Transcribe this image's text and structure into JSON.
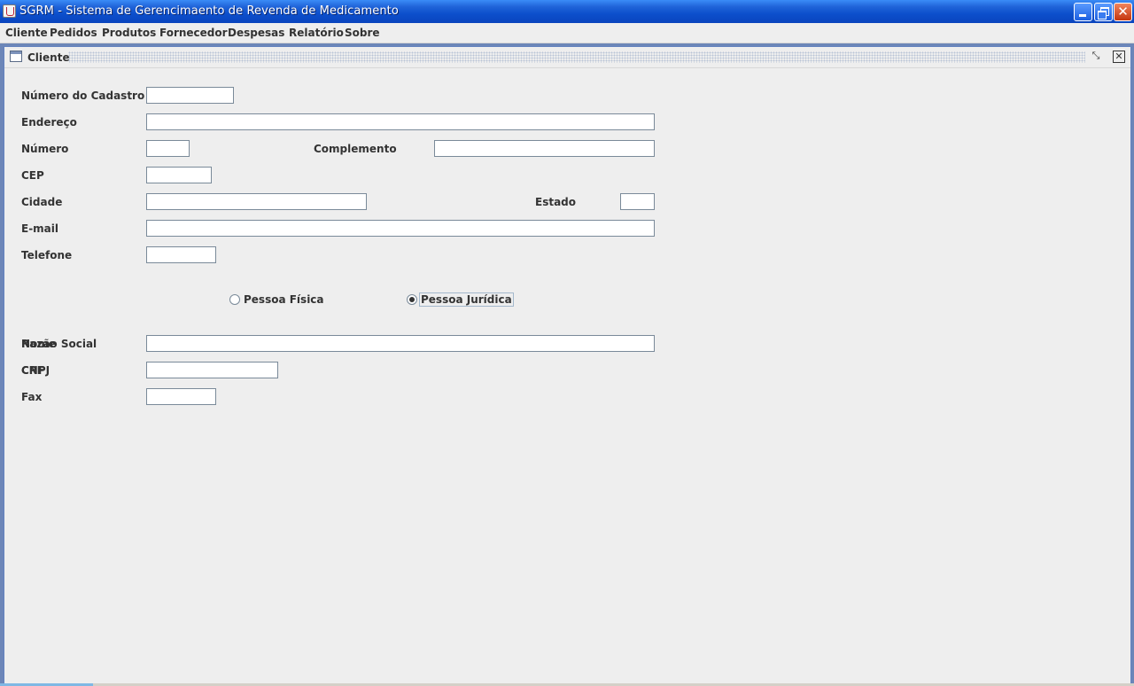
{
  "window": {
    "title": "SGRM - Sistema de Gerencimaento de Revenda de Medicamento",
    "close_glyph": "✕"
  },
  "menu": [
    "Cliente",
    "Pedidos",
    "Produtos",
    "Fornecedor",
    "Despesas",
    "Relatório",
    "Sobre"
  ],
  "internal_frame": {
    "title": "Cliente",
    "restore_glyph": "⤡",
    "close_glyph": "✕"
  },
  "form": {
    "numero_cadastro_label": "Número do Cadastro",
    "endereco_label": "Endereço",
    "numero_label": "Número",
    "complemento_label": "Complemento",
    "cep_label": "CEP",
    "cidade_label": "Cidade",
    "estado_label": "Estado",
    "email_label": "E-mail",
    "telefone_label": "Telefone",
    "pessoa_fisica_label": "Pessoa Física",
    "pessoa_juridica_label": "Pessoa Jurídica",
    "selected_pessoa": "Pessoa Jurídica",
    "nome_label": "Nome",
    "razao_social_label": "Razão Social",
    "cpf_label": "CPF",
    "cnpj_label": "CNPJ",
    "fax_label": "Fax",
    "values": {
      "numero_cadastro": "",
      "endereco": "",
      "numero": "",
      "complemento": "",
      "cep": "",
      "cidade": "",
      "estado": "",
      "email": "",
      "telefone": "",
      "razao_social": "",
      "cnpj": "",
      "fax": ""
    }
  }
}
